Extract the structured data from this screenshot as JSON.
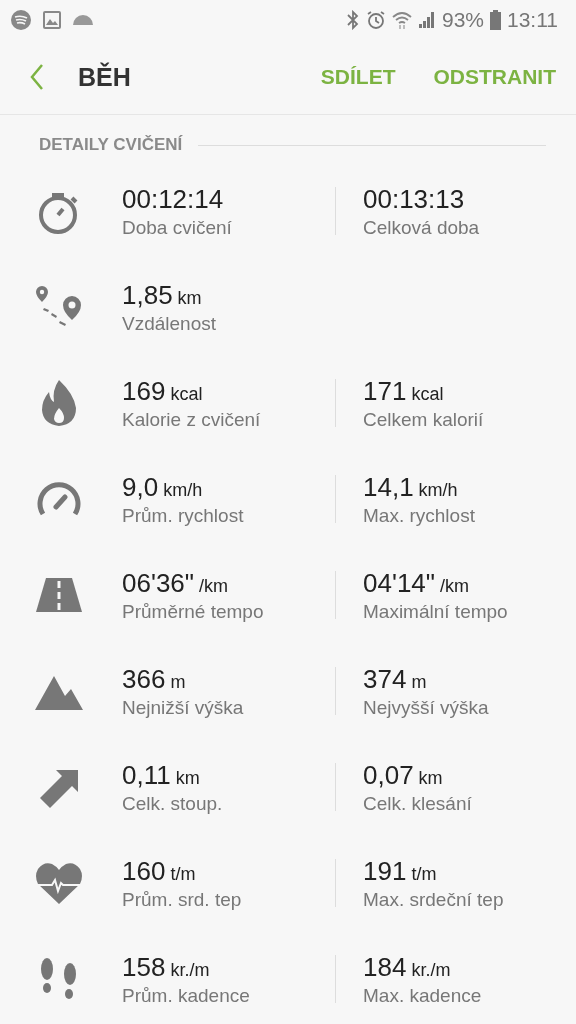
{
  "status_bar": {
    "battery": "93%",
    "time": "13:11"
  },
  "header": {
    "title": "BĚH",
    "actions": [
      "SDÍLET",
      "ODSTRANIT"
    ]
  },
  "section": {
    "title": "DETAILY CVIČENÍ"
  },
  "rows": [
    {
      "kind": "stopwatch",
      "left": {
        "value": "00:12:14",
        "label": "Doba cvičení"
      },
      "right": {
        "value": "00:13:13",
        "label": "Celková doba"
      }
    },
    {
      "kind": "route",
      "left": {
        "value": "1,85",
        "unit": "km",
        "label": "Vzdálenost"
      }
    },
    {
      "kind": "flame",
      "left": {
        "value": "169",
        "unit": "kcal",
        "label": "Kalorie z cvičení"
      },
      "right": {
        "value": "171",
        "unit": "kcal",
        "label": "Celkem kalorií"
      }
    },
    {
      "kind": "speed",
      "left": {
        "value": "9,0",
        "unit": "km/h",
        "label": "Prům. rychlost"
      },
      "right": {
        "value": "14,1",
        "unit": "km/h",
        "label": "Max. rychlost"
      }
    },
    {
      "kind": "road",
      "left": {
        "value": "06'36\"",
        "unit": "/km",
        "label": "Průměrné tempo"
      },
      "right": {
        "value": "04'14\"",
        "unit": "/km",
        "label": "Maximální tempo"
      }
    },
    {
      "kind": "mountain",
      "left": {
        "value": "366",
        "unit": "m",
        "label": "Nejnižší výška"
      },
      "right": {
        "value": "374",
        "unit": "m",
        "label": "Nejvyšší výška"
      }
    },
    {
      "kind": "ascent",
      "left": {
        "value": "0,11",
        "unit": "km",
        "label": "Celk. stoup."
      },
      "right": {
        "value": "0,07",
        "unit": "km",
        "label": "Celk. klesání"
      }
    },
    {
      "kind": "heart",
      "left": {
        "value": "160",
        "unit": "t/m",
        "label": "Prům. srd. tep"
      },
      "right": {
        "value": "191",
        "unit": "t/m",
        "label": "Max. srdeční tep"
      }
    },
    {
      "kind": "steps",
      "left": {
        "value": "158",
        "unit": "kr./m",
        "label": "Prům. kadence"
      },
      "right": {
        "value": "184",
        "unit": "kr./m",
        "label": "Max. kadence"
      }
    }
  ]
}
